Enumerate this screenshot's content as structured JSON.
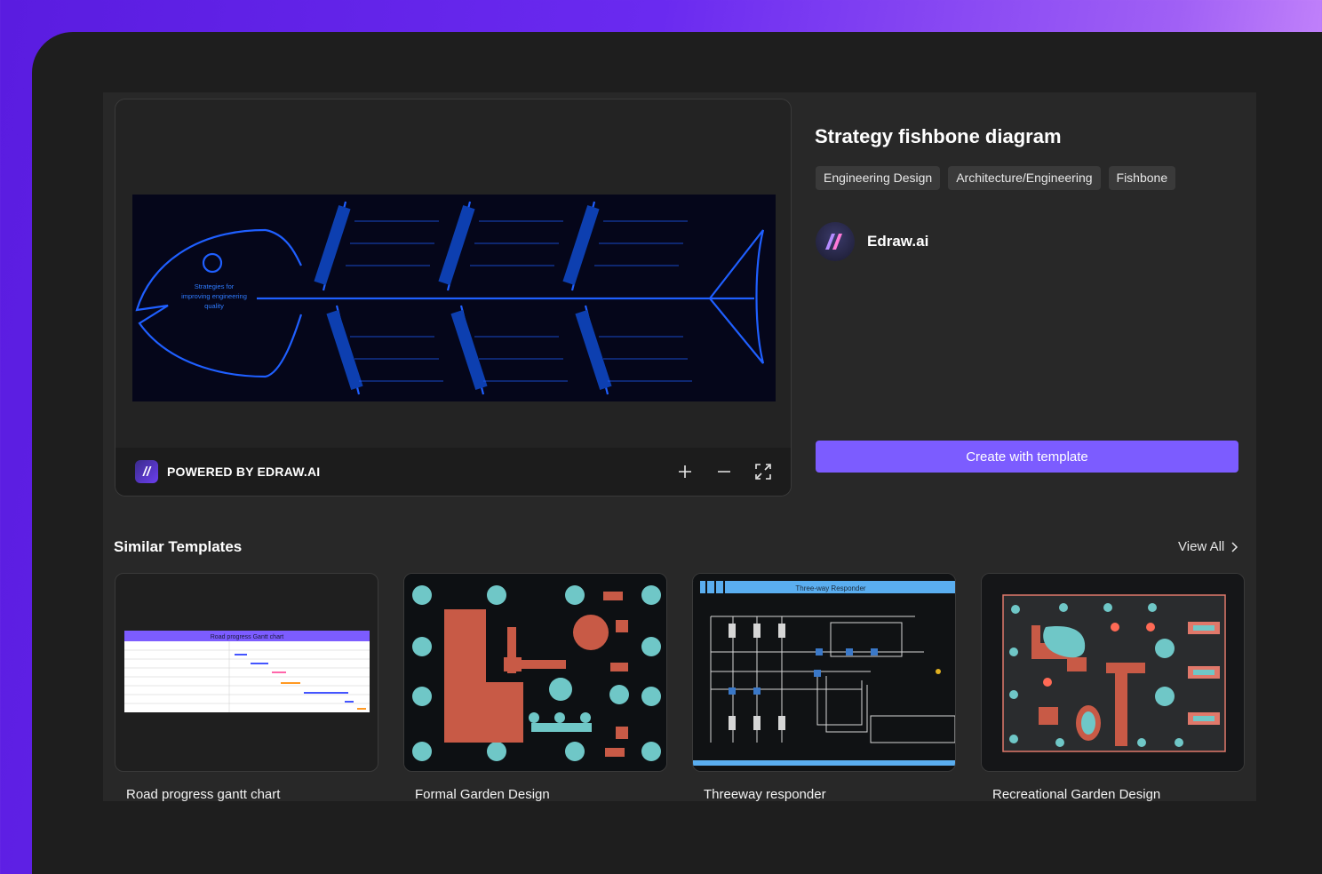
{
  "template": {
    "title": "Strategy fishbone diagram",
    "tags": [
      "Engineering Design",
      "Architecture/Engineering",
      "Fishbone"
    ],
    "author": "Edraw.ai",
    "create_label": "Create with template"
  },
  "preview": {
    "powered_label": "POWERED BY EDRAW.AI",
    "fish_head_text": [
      "Strategies for",
      "improving engineering",
      "quality"
    ],
    "tools": [
      "plus-icon",
      "minus-icon",
      "fullscreen-icon"
    ]
  },
  "similar": {
    "title": "Similar Templates",
    "view_all": "View All",
    "cards": [
      {
        "label": "Road progress gantt chart",
        "thumb_title": "Road progress Gantt chart"
      },
      {
        "label": "Formal Garden Design"
      },
      {
        "label": "Threeway responder",
        "thumb_title": "Three-way Responder"
      },
      {
        "label": "Recreational Garden Design"
      }
    ]
  },
  "colors": {
    "accent": "#7c5cff",
    "fish_line": "#1f5fff",
    "panel": "#282828"
  }
}
